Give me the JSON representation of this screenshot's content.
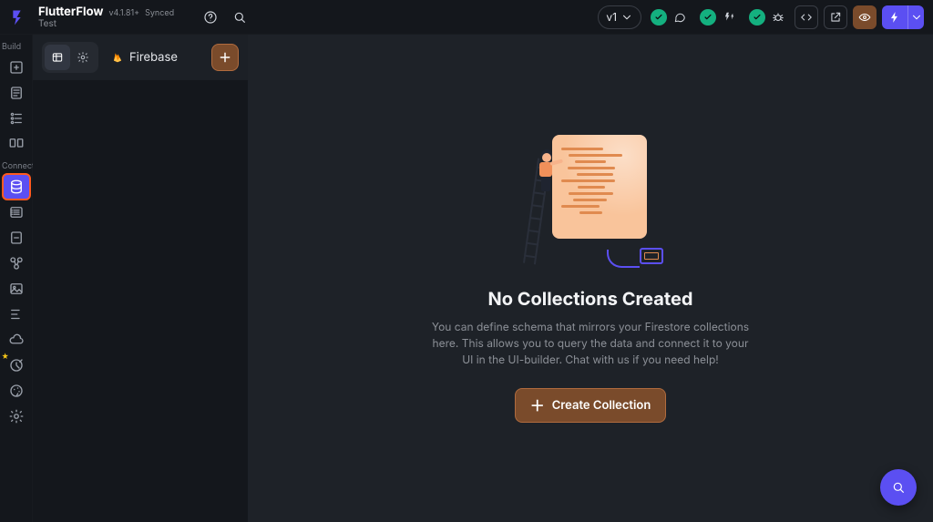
{
  "header": {
    "app_name": "FlutterFlow",
    "version": "v4.1.81+",
    "sync_status": "Synced",
    "project_name": "Test",
    "version_chip": "v1"
  },
  "rail": {
    "section_build": "Build",
    "section_connect": "Connect"
  },
  "panel": {
    "firebase_label": "Firebase"
  },
  "main": {
    "title": "No Collections Created",
    "description": "You can define schema that mirrors your Firestore collections here. This allows you to query the data and connect it to your UI in the UI-builder. Chat with us if you need help!",
    "button_label": "Create Collection"
  }
}
